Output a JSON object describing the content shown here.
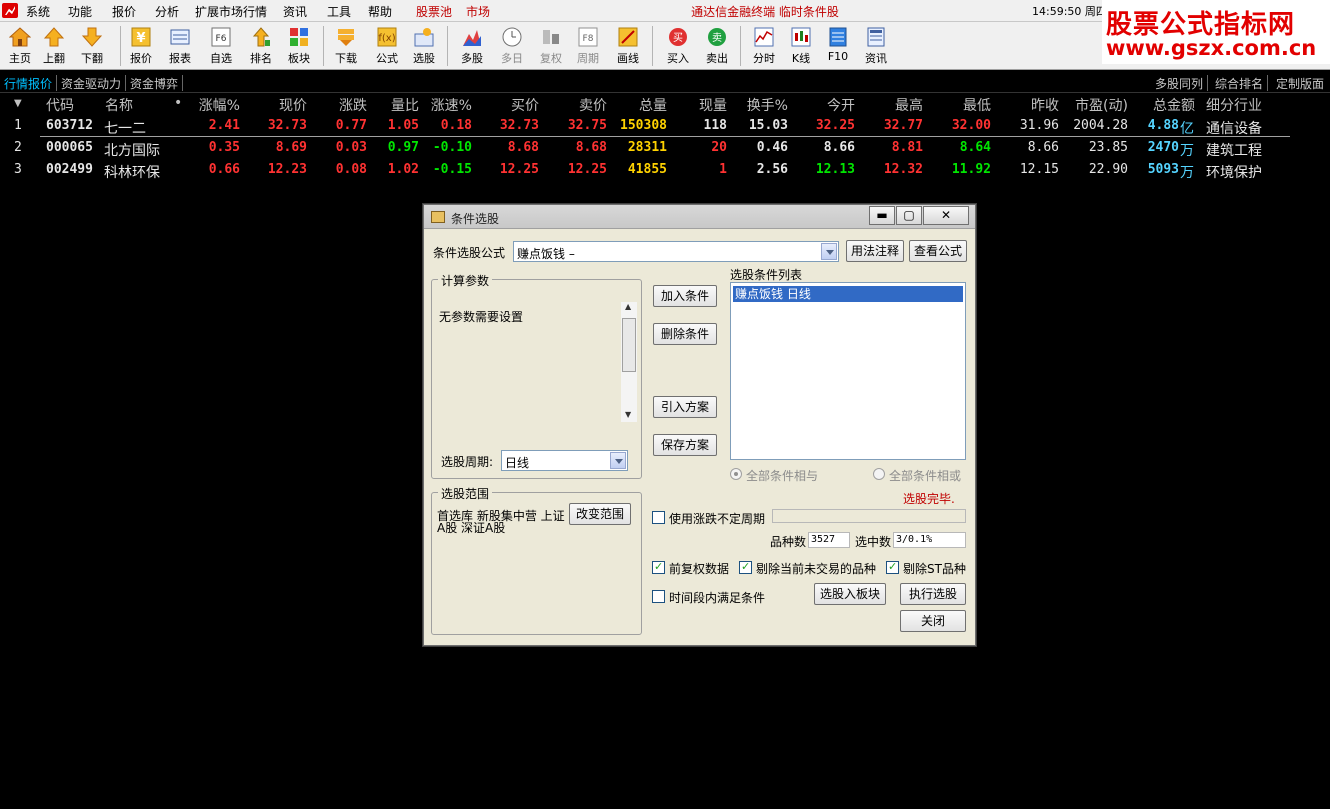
{
  "menu": {
    "items": [
      "系统",
      "功能",
      "报价",
      "分析",
      "扩展市场行情",
      "资讯",
      "工具",
      "帮助",
      "股票池",
      "市场"
    ],
    "ticker": "通达信金融终端  临时条件股",
    "clock": "14:59:50 周四"
  },
  "watermark": {
    "line1": "股票公式指标网",
    "line2": "www.gszx.com.cn"
  },
  "toolbar": [
    {
      "label": "主页",
      "icon": "home-icon"
    },
    {
      "label": "上翻",
      "icon": "arrow-up-icon"
    },
    {
      "label": "下翻",
      "icon": "arrow-down-icon"
    },
    {
      "label": "报价",
      "icon": "quote-icon"
    },
    {
      "label": "报表",
      "icon": "report-icon"
    },
    {
      "label": "自选",
      "icon": "f6-icon"
    },
    {
      "label": "排名",
      "icon": "rank-icon"
    },
    {
      "label": "板块",
      "icon": "block-icon"
    },
    {
      "label": "下载",
      "icon": "download-icon"
    },
    {
      "label": "公式",
      "icon": "formula-icon"
    },
    {
      "label": "选股",
      "icon": "stock-pick-icon"
    },
    {
      "label": "多股",
      "icon": "multi-stock-icon"
    },
    {
      "label": "多日",
      "icon": "multi-day-icon"
    },
    {
      "label": "复权",
      "icon": "adjust-icon"
    },
    {
      "label": "周期",
      "icon": "f8-icon"
    },
    {
      "label": "画线",
      "icon": "draw-line-icon"
    },
    {
      "label": "买入",
      "icon": "buy-icon"
    },
    {
      "label": "卖出",
      "icon": "sell-icon"
    },
    {
      "label": "分时",
      "icon": "intraday-icon"
    },
    {
      "label": "K线",
      "icon": "kline-icon"
    },
    {
      "label": "F10",
      "icon": "f10-icon"
    },
    {
      "label": "资讯",
      "icon": "news-icon"
    }
  ],
  "tabs_left": [
    "行情报价",
    "资金驱动力",
    "资金博弈"
  ],
  "tabs_right": [
    "多股同列",
    "综合排名",
    "定制版面"
  ],
  "columns": [
    "代码",
    "名称",
    "•",
    "涨幅%",
    "现价",
    "涨跌",
    "量比",
    "涨速%",
    "买价",
    "卖价",
    "总量",
    "现量",
    "换手%",
    "今开",
    "最高",
    "最低",
    "昨收",
    "市盈(动)",
    "总金额",
    "细分行业"
  ],
  "rows": [
    {
      "n": "1",
      "code": "603712",
      "name": "七一二",
      "chg_pct": "2.41",
      "price": "32.73",
      "chg": "0.77",
      "vr": "1.05",
      "speed": "0.18",
      "bid": "32.73",
      "ask": "32.75",
      "vol": "150308",
      "cur": "118",
      "turn": "15.03",
      "open": "32.25",
      "high": "32.77",
      "low": "32.00",
      "prev": "31.96",
      "pe": "2004.28",
      "amt": "4.88",
      "amt_unit": "亿",
      "ind": "通信设备"
    },
    {
      "n": "2",
      "code": "000065",
      "name": "北方国际",
      "chg_pct": "0.35",
      "price": "8.69",
      "chg": "0.03",
      "vr": "0.97",
      "speed": "-0.10",
      "bid": "8.68",
      "ask": "8.68",
      "vol": "28311",
      "cur": "20",
      "turn": "0.46",
      "open": "8.66",
      "high": "8.81",
      "low": "8.64",
      "prev": "8.66",
      "pe": "23.85",
      "amt": "2470",
      "amt_unit": "万",
      "ind": "建筑工程"
    },
    {
      "n": "3",
      "code": "002499",
      "name": "科林环保",
      "chg_pct": "0.66",
      "price": "12.23",
      "chg": "0.08",
      "vr": "1.02",
      "speed": "-0.15",
      "bid": "12.25",
      "ask": "12.25",
      "vol": "41855",
      "cur": "1",
      "turn": "2.56",
      "open": "12.13",
      "high": "12.32",
      "low": "11.92",
      "prev": "12.15",
      "pe": "22.90",
      "amt": "5093",
      "amt_unit": "万",
      "ind": "环境保护"
    }
  ],
  "dialog": {
    "title": "条件选股",
    "minimize": "▬",
    "maximize": "▢",
    "close": "✕",
    "formula_label": "条件选股公式",
    "formula_value": "赚点饭钱        –",
    "usage_btn": "用法注释",
    "view_btn": "查看公式",
    "params_group": "计算参数",
    "params_text": "无参数需要设置",
    "period_label": "选股周期:",
    "period_value": "日线",
    "add_btn": "加入条件",
    "del_btn": "删除条件",
    "import_btn": "引入方案",
    "save_btn": "保存方案",
    "list_label": "选股条件列表",
    "list_item": "赚点饭钱    日线",
    "radio_and": "全部条件相与",
    "radio_or": "全部条件相或",
    "status": "选股完毕.",
    "scope_group": "选股范围",
    "scope_text": "首选库  新股集中营  上证A股  深证A股",
    "change_scope_btn": "改变范围",
    "chk_unfixed": "使用涨跌不定周期",
    "count_label": "品种数",
    "count_value": "3527",
    "selected_label": "选中数",
    "selected_value": "3/0.1%",
    "chk_fq": "前复权数据",
    "chk_exclude_untraded": "剔除当前未交易的品种",
    "chk_exclude_st": "剔除ST品种",
    "chk_time": "时间段内满足条件",
    "to_block_btn": "选股入板块",
    "execute_btn": "执行选股",
    "close_btn": "关闭"
  }
}
